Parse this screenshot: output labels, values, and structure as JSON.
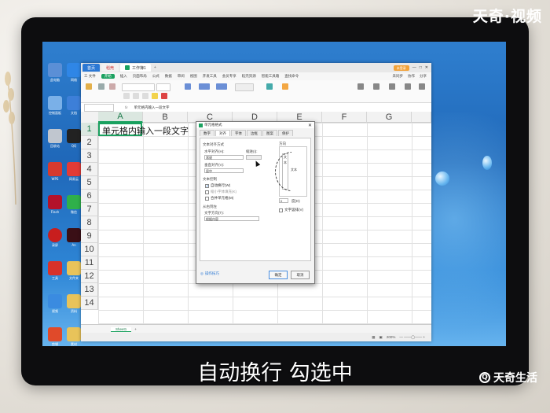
{
  "watermark": "天奇·视频",
  "caption": "自动换行 勾选中",
  "brand": {
    "name": "天奇生活"
  },
  "colors": {
    "accent_green": "#1aa15f",
    "wps_blue": "#2b78d4",
    "screen_blue": "#1f67b8"
  },
  "titlebar": {
    "tabs": [
      {
        "label": "首页",
        "icon": "home-icon"
      },
      {
        "label": "稻壳",
        "icon": "docer-icon"
      },
      {
        "label": "工作簿1",
        "icon": "xlsx-icon"
      }
    ],
    "new_tab": "+",
    "login": "未登录"
  },
  "menubar": {
    "items": [
      "三 文件",
      "开始",
      "插入",
      "页面布局",
      "公式",
      "数据",
      "审阅",
      "视图",
      "开发工具",
      "会员专享",
      "稻壳资源",
      "智能工具箱"
    ],
    "active": "开始",
    "search": "查找命令",
    "right": [
      "未同步",
      "协作",
      "分享"
    ]
  },
  "formula": {
    "fx": "fx",
    "value": "单元格内输入一段文字"
  },
  "columns": [
    "A",
    "B",
    "C",
    "D",
    "E",
    "F",
    "G"
  ],
  "rows": [
    "1",
    "2",
    "3",
    "4",
    "5",
    "6",
    "7",
    "8",
    "9",
    "10",
    "11",
    "12",
    "13",
    "14"
  ],
  "cell_a1": "单元格内输入一段文字",
  "sheet": {
    "tab": "Sheet1",
    "add": "+"
  },
  "status": {
    "zoom": "200%"
  },
  "dialog": {
    "title": "单元格格式",
    "tabs": [
      "数字",
      "对齐",
      "字体",
      "边框",
      "图案",
      "保护"
    ],
    "active_tab": "对齐",
    "text_align_group": "文本对齐方式",
    "horizontal_label": "水平对齐(H):",
    "horizontal_value": "常规",
    "indent_label": "缩进(I):",
    "vertical_label": "垂直对齐(V):",
    "vertical_value": "居中",
    "text_control_group": "文本控制",
    "wrap_text": {
      "label": "自动换行(W)",
      "checked": true
    },
    "shrink_to_fit": {
      "label": "缩小字体填充(K)",
      "checked": false
    },
    "merge_cells": {
      "label": "合并单元格(M)",
      "checked": false
    },
    "rtl_group": "从右到左",
    "text_direction_label": "文字方向(T):",
    "text_direction_value": "根据内容",
    "orientation_group": "方向",
    "orientation_vertical": "文本",
    "orientation_text": "文本",
    "degree_value": "0",
    "degree_label": "度(D)",
    "vertical_text": {
      "label": "文字竖排(V)",
      "checked": false
    },
    "tips": "操作技巧",
    "ok": "确定",
    "cancel": "取消"
  }
}
